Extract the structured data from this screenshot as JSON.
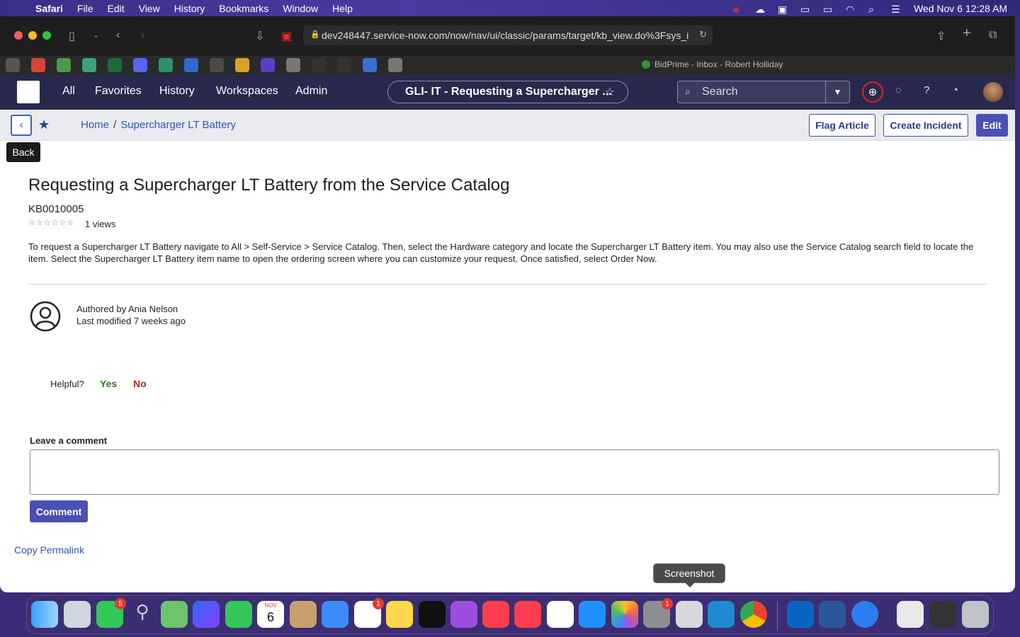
{
  "menubar": {
    "app": "Safari",
    "items": [
      "File",
      "Edit",
      "View",
      "History",
      "Bookmarks",
      "Window",
      "Help"
    ],
    "datetime": "Wed Nov 6  12:28 AM"
  },
  "browser": {
    "url": "dev248447.service-now.com/now/nav/ui/classic/params/target/kb_view.do%3Fsys_i",
    "tab_info": "BidPrime - Inbox - Robert Holliday"
  },
  "snheader": {
    "nav": [
      "All",
      "Favorites",
      "History",
      "Workspaces",
      "Admin"
    ],
    "context_title": "GLI- IT - Requesting a Supercharger ...",
    "search_placeholder": "Search"
  },
  "kbbar": {
    "back_tooltip": "Back",
    "breadcrumb": [
      "Home",
      "Supercharger LT Battery"
    ],
    "buttons": {
      "flag": "Flag Article",
      "incident": "Create Incident",
      "edit": "Edit"
    }
  },
  "article": {
    "title": "Requesting a Supercharger LT Battery from the Service Catalog",
    "number": "KB0010005",
    "stars": "☆☆☆☆☆☆",
    "views": "1 views",
    "body": "To request a Supercharger LT Battery navigate to All > Self-Service > Service Catalog. Then, select the Hardware category and locate the Supercharger LT Battery item. You may also use the Service Catalog search field to locate the item. Select the Supercharger LT Battery item name to open the ordering screen where you can customize your request. Once satisfied, select Order Now.",
    "authored_by": "Authored by Ania Nelson",
    "last_modified": "Last modified 7 weeks ago",
    "helpful_label": "Helpful?",
    "yes": "Yes",
    "no": "No",
    "comment_label": "Leave a comment",
    "comment_button": "Comment",
    "permalink": "Copy Permalink"
  },
  "dock": {
    "tooltip": "Screenshot",
    "calendar_month": "NOV",
    "calendar_day": "6",
    "badges": {
      "messages": "5",
      "reminders": "1",
      "settings": "1"
    }
  },
  "colors": {
    "accent": "#4a4fb3",
    "header": "#28294d",
    "link": "#2f55b8",
    "yes": "#2e7d1f",
    "no": "#b3261e"
  }
}
